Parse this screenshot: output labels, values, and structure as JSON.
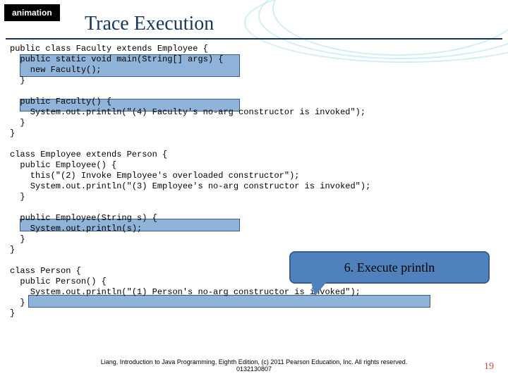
{
  "badge": "animation",
  "title": "Trace Execution",
  "code": "public class Faculty extends Employee {\n  public static void main(String[] args) {\n    new Faculty();\n  }\n\n  public Faculty() {\n    System.out.println(\"(4) Faculty's no-arg constructor is invoked\");\n  }\n}\n\nclass Employee extends Person {\n  public Employee() {\n    this(\"(2) Invoke Employee's overloaded constructor\");\n    System.out.println(\"(3) Employee's no-arg constructor is invoked\");\n  }\n\n  public Employee(String s) {\n    System.out.println(s);\n  }\n}\n\nclass Person {\n  public Person() {\n    System.out.println(\"(1) Person's no-arg constructor is invoked\");\n  }\n}",
  "callout": "6. Execute println",
  "footer": "Liang, Introduction to Java Programming, Eighth Edition, (c) 2011 Pearson Education, Inc. All rights reserved. 0132130807",
  "pagenum": "19"
}
